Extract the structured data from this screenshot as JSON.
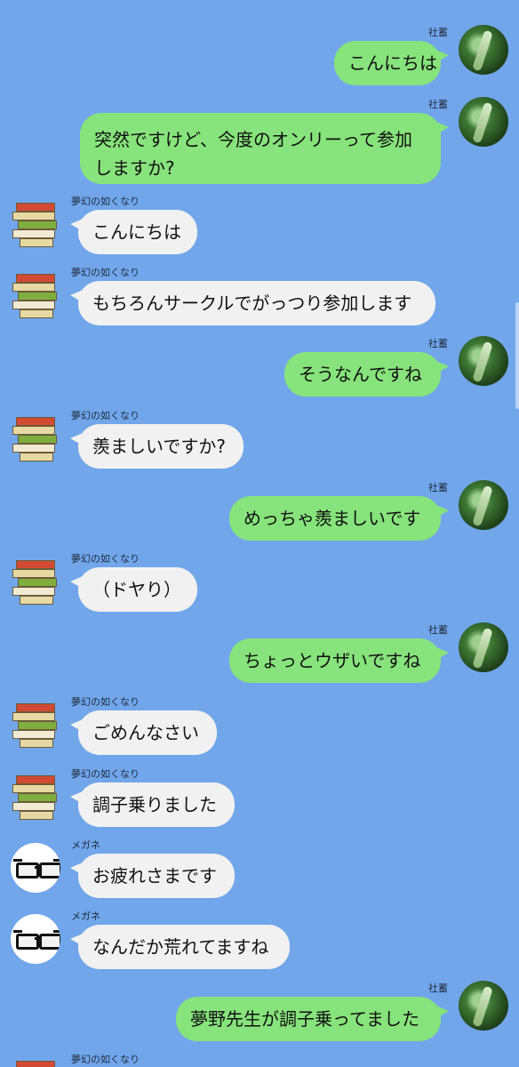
{
  "colors": {
    "background": "#71a6eb",
    "outgoing_bubble": "#87e37b",
    "incoming_bubble": "#f1f1f1"
  },
  "messages": [
    {
      "side": "right",
      "sender": "社蓄",
      "text": "こんにちは",
      "avatar": "forest-avatar"
    },
    {
      "side": "right",
      "sender": "社蓄",
      "text": "突然ですけど、今度のオンリーって参加しますか?",
      "avatar": "forest-avatar"
    },
    {
      "side": "left",
      "sender": "夢幻の如くなり",
      "text": "こんにちは",
      "avatar": "books-avatar"
    },
    {
      "side": "left",
      "sender": "夢幻の如くなり",
      "text": "もちろんサークルでがっつり参加します",
      "avatar": "books-avatar"
    },
    {
      "side": "right",
      "sender": "社蓄",
      "text": "そうなんですね",
      "avatar": "forest-avatar"
    },
    {
      "side": "left",
      "sender": "夢幻の如くなり",
      "text": "羨ましいですか?",
      "avatar": "books-avatar"
    },
    {
      "side": "right",
      "sender": "社蓄",
      "text": "めっちゃ羨ましいです",
      "avatar": "forest-avatar"
    },
    {
      "side": "left",
      "sender": "夢幻の如くなり",
      "text": "（ドヤり）",
      "avatar": "books-avatar"
    },
    {
      "side": "right",
      "sender": "社蓄",
      "text": "ちょっとウザいですね",
      "avatar": "forest-avatar"
    },
    {
      "side": "left",
      "sender": "夢幻の如くなり",
      "text": "ごめんなさい",
      "avatar": "books-avatar"
    },
    {
      "side": "left",
      "sender": "夢幻の如くなり",
      "text": "調子乗りました",
      "avatar": "books-avatar"
    },
    {
      "side": "left",
      "sender": "メガネ",
      "text": "お疲れさまです",
      "avatar": "glasses-avatar"
    },
    {
      "side": "left",
      "sender": "メガネ",
      "text": "なんだか荒れてますね",
      "avatar": "glasses-avatar"
    },
    {
      "side": "right",
      "sender": "社蓄",
      "text": "夢野先生が調子乗ってました",
      "avatar": "forest-avatar"
    },
    {
      "side": "left",
      "sender": "夢幻の如くなり",
      "text": "",
      "avatar": "books-avatar"
    }
  ]
}
